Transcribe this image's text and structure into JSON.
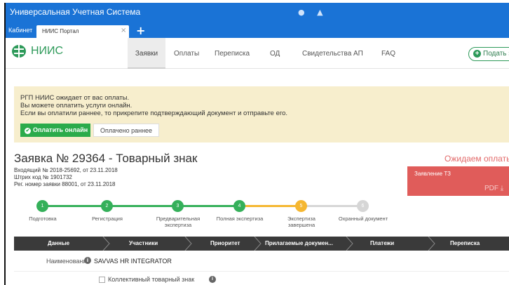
{
  "window": {
    "title": "Универсальная Учетная Система",
    "status_icons": [
      "info-icon",
      "bell-icon"
    ]
  },
  "tabs": {
    "left_label": "Кабинет",
    "active_label": "НИИС Портал",
    "close_glyph": "×",
    "add_glyph": "+"
  },
  "header": {
    "logo_text": "НИИС",
    "nav": [
      "Заявки",
      "Оплаты",
      "Переписка",
      "ОД",
      "Свидетельства АП",
      "FAQ"
    ],
    "active_nav_index": 0,
    "submit_label": "Подать за"
  },
  "notice": {
    "line1": "РГП НИИС ожидает от вас оплаты.",
    "line2": "Вы можете оплатить услуги онлайн.",
    "line3": "Если вы оплатили раннее, то прикрепите подтверждающий документ и отправьте его.",
    "pay_button": "Оплатить онлайн",
    "paid_button": "Оплачено раннее"
  },
  "application": {
    "title": "Заявка № 29364 - Товарный знак",
    "status": "Ожидаем оплаты",
    "incoming": "Входящий № 2018-25692, от 23.11.2018",
    "barcode": "Штрих код № 1901732",
    "reg_number": "Рег. номер заявки 88001, от 23.11.2018",
    "doc_name": "Заявление ТЗ",
    "doc_link": "PDF ⤓"
  },
  "stepper": {
    "current_step": 5,
    "steps": [
      {
        "n": "1",
        "label": "Подготовка",
        "state": "done"
      },
      {
        "n": "2",
        "label": "Регистрация",
        "state": "done"
      },
      {
        "n": "3",
        "label": "Предварительная экспертиза",
        "state": "done"
      },
      {
        "n": "4",
        "label": "Полная экспертиза",
        "state": "done"
      },
      {
        "n": "5",
        "label": "Экспертиза завершена",
        "state": "current"
      },
      {
        "n": "6",
        "label": "Охранный документ",
        "state": "todo"
      }
    ]
  },
  "section_tabs": [
    "Данные",
    "Участники",
    "Приоритет",
    "Прилагаемые докумен...",
    "Платежи",
    "Переписка"
  ],
  "fields": {
    "name_label": "Наименование",
    "name_value": "SAVVAS HR INTEGRATOR",
    "collective_label": "Коллективный товарный знак",
    "collective_checked": false
  },
  "colors": {
    "titlebar": "#1a73d6",
    "accent_green": "#2bab4b",
    "notice_bg": "#f7eecd",
    "status_red": "#e26a6a",
    "step_current": "#f5b731",
    "tabs_dark": "#3a3a3a"
  }
}
